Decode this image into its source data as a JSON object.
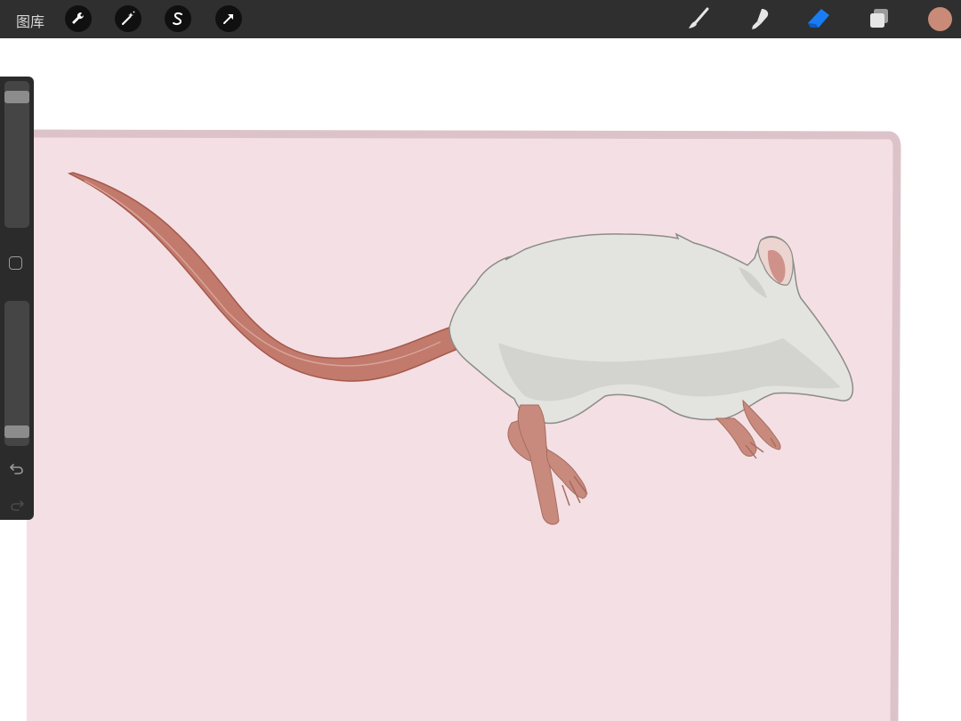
{
  "topbar": {
    "gallery_label": "图库",
    "left_tools": [
      "wrench-icon",
      "magic-wand-icon",
      "selection-s-icon",
      "transform-arrow-icon"
    ],
    "right_tools": [
      "brush-icon",
      "smudge-icon",
      "eraser-icon",
      "layers-icon"
    ],
    "active_tool": "eraser",
    "current_color": "#c98a78",
    "active_tool_color": "#1a7cf5"
  },
  "sidebar": {
    "brush_size_level": 0.93,
    "opacity_level": 0.06
  },
  "canvas": {
    "paper_color": "#f4e0e4",
    "mouse_body_color": "#e3e3df",
    "tail_color": "#c17a6c"
  }
}
